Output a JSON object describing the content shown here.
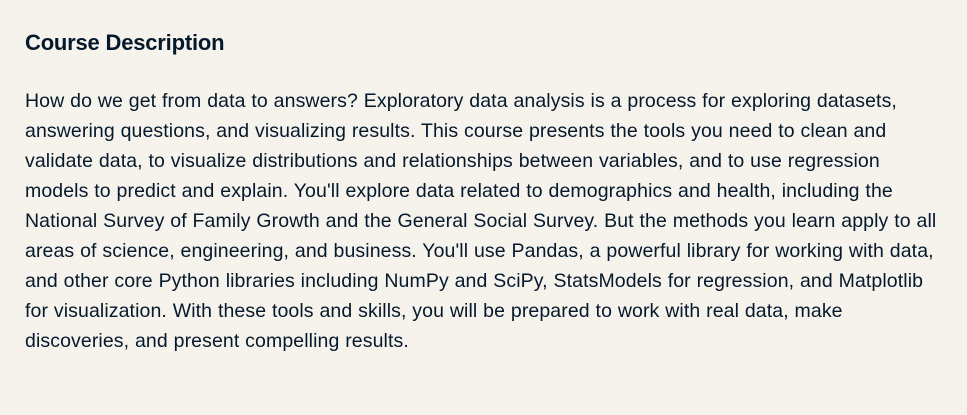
{
  "course_description": {
    "heading": "Course Description",
    "body": "How do we get from data to answers? Exploratory data analysis is a process for exploring datasets, answering questions, and visualizing results. This course presents the tools you need to clean and validate data, to visualize distributions and relationships between variables, and to use regression models to predict and explain. You'll explore data related to demographics and health, including the National Survey of Family Growth and the General Social Survey. But the methods you learn apply to all areas of science, engineering, and business. You'll use Pandas, a powerful library for working with data, and other core Python libraries including NumPy and SciPy, StatsModels for regression, and Matplotlib for visualization. With these tools and skills, you will be prepared to work with real data, make discoveries, and present compelling results."
  }
}
